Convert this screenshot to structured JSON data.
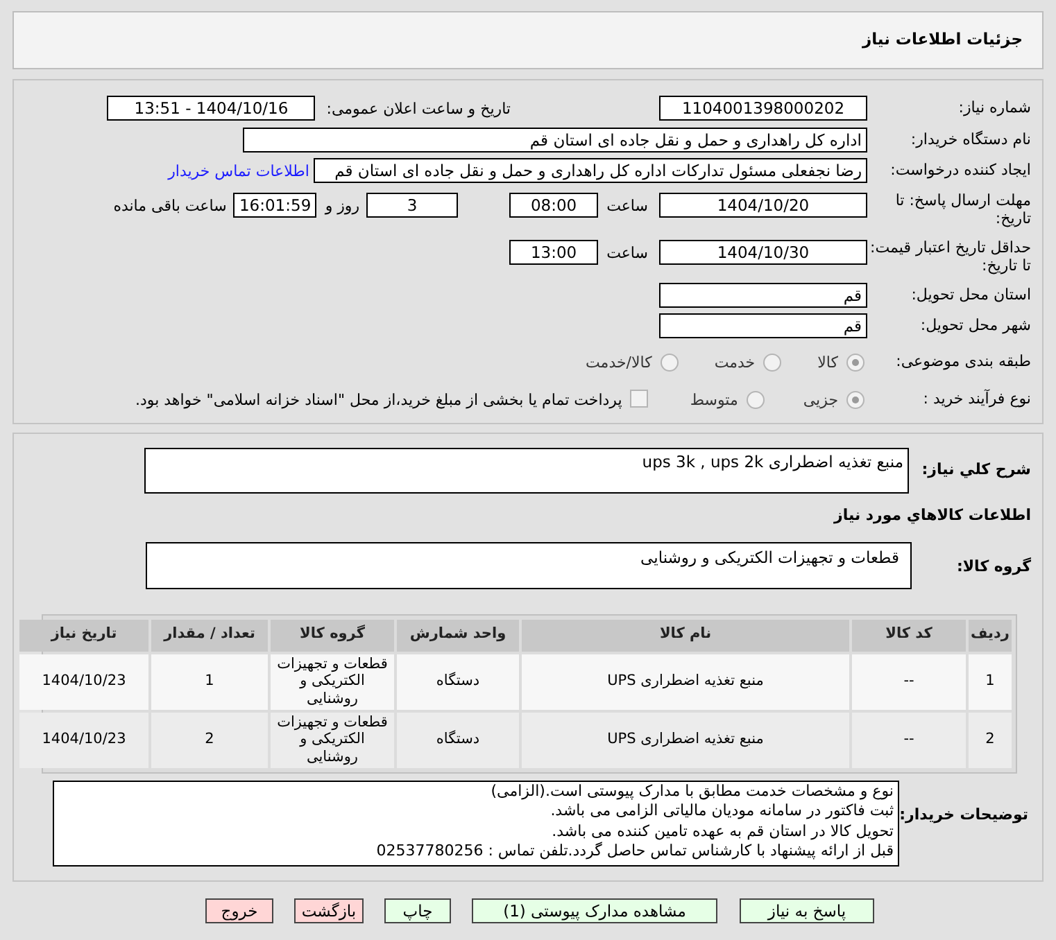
{
  "header": {
    "title": "جزئیات اطلاعات نیاز"
  },
  "need_number": {
    "label": "شماره نیاز:",
    "value": "1104001398000202"
  },
  "announce": {
    "label": "تاریخ و ساعت اعلان عمومی:",
    "value": "1404/10/16 - 13:51"
  },
  "buyer_org": {
    "label": "نام دستگاه خریدار:",
    "value": "اداره کل راهداری و حمل و نقل جاده ای استان قم"
  },
  "requester": {
    "label": "ایجاد کننده درخواست:",
    "value": "رضا  نجفعلی مسئول تدارکات اداره کل راهداری و حمل و نقل جاده ای استان قم",
    "link": "اطلاعات تماس خریدار"
  },
  "deadline": {
    "label": "مهلت ارسال پاسخ: تا تاریخ:",
    "date": "1404/10/20",
    "time_label": "ساعت",
    "time": "08:00",
    "days": "3",
    "days_label": "روز و",
    "remaining": "16:01:59",
    "remaining_label": "ساعت باقی مانده"
  },
  "validity": {
    "label": "حداقل تاریخ اعتبار قیمت: تا تاریخ:",
    "date": "1404/10/30",
    "time_label": "ساعت",
    "time": "13:00"
  },
  "province": {
    "label": "استان محل تحویل:",
    "value": "قم"
  },
  "city": {
    "label": "شهر محل تحویل:",
    "value": "قم"
  },
  "category": {
    "label": "طبقه بندی موضوعی:",
    "options": [
      {
        "label": "کالا",
        "selected": true
      },
      {
        "label": "خدمت",
        "selected": false
      },
      {
        "label": "کالا/خدمت",
        "selected": false
      }
    ]
  },
  "process": {
    "label": "نوع فرآیند خرید :",
    "options": [
      {
        "label": "جزیی",
        "selected": true
      },
      {
        "label": "متوسط",
        "selected": false
      }
    ],
    "payment": {
      "label": "پرداخت تمام یا بخشی از مبلغ خرید،از محل \"اسناد خزانه اسلامی\" خواهد بود.",
      "checked": false
    }
  },
  "description": {
    "label": "شرح کلي نياز:",
    "value": "منبع تغذیه اضطراری ups 3k , ups 2k"
  },
  "goods_heading": "اطلاعات کالاهاي مورد نياز",
  "goods_group": {
    "label": "گروه کالا:",
    "value": "قطعات و تجهیزات الکتریکی و روشنایی"
  },
  "table": {
    "columns": [
      "ردیف",
      "کد کالا",
      "نام کالا",
      "واحد شمارش",
      "گروه کالا",
      "تعداد / مقدار",
      "تاریخ نیاز"
    ],
    "rows": [
      [
        "1",
        "--",
        "منبع تغذیه اضطراری UPS",
        "دستگاه",
        "قطعات و تجهیزات الکتریکی و روشنایی",
        "1",
        "1404/10/23"
      ],
      [
        "2",
        "--",
        "منبع تغذیه اضطراری UPS",
        "دستگاه",
        "قطعات و تجهیزات الکتریکی و روشنایی",
        "2",
        "1404/10/23"
      ]
    ]
  },
  "buyer_notes": {
    "label": "توضیحات خریدار:",
    "lines": [
      "نوع و مشخصات خدمت مطابق با مدارک پیوستی است.(الزامی)",
      "ثبت فاکتور در سامانه مودیان مالیاتی الزامی می باشد.",
      "تحویل کالا در استان قم به عهده تامین کننده می باشد.",
      "قبل از ارائه پیشنهاد با کارشناس تماس حاصل گردد.تلفن تماس : 02537780256"
    ]
  },
  "buttons": [
    {
      "label": "پاسخ به نیاز",
      "kind": "primary"
    },
    {
      "label": "مشاهده مدارک پیوستی (1)",
      "kind": "primary"
    },
    {
      "label": "چاپ",
      "kind": "primary"
    },
    {
      "label": "بازگشت",
      "kind": "danger"
    },
    {
      "label": "خروج",
      "kind": "danger"
    }
  ]
}
